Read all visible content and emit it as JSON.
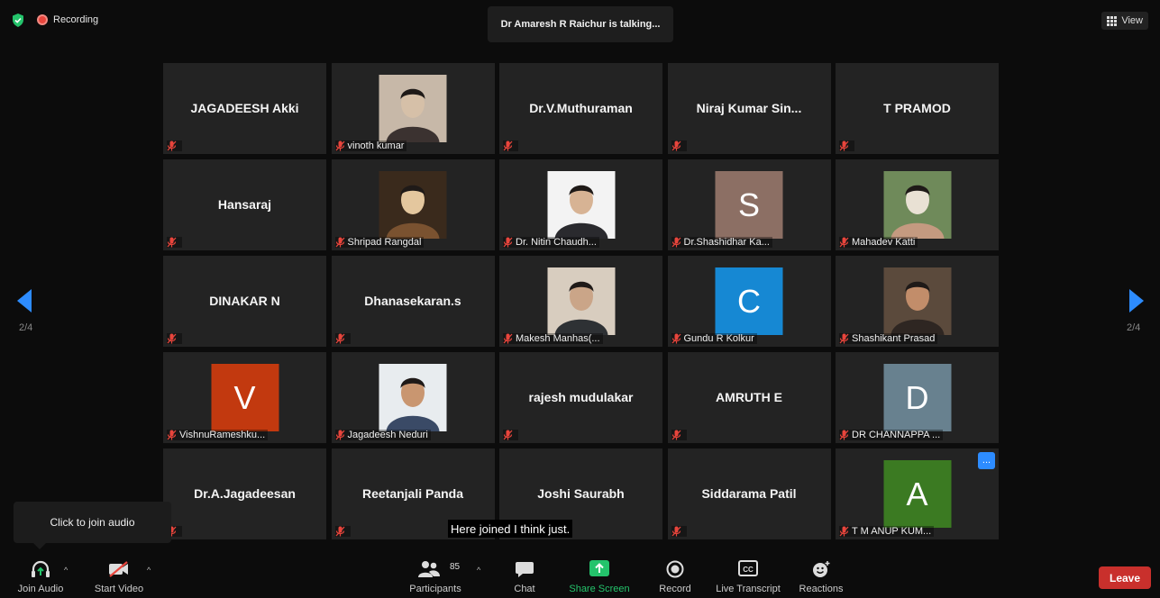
{
  "top": {
    "recording_label": "Recording",
    "talking_text": "Dr Amaresh R Raichur is talking...",
    "view_label": "View"
  },
  "page_indicator_left": "2/4",
  "page_indicator_right": "2/4",
  "tiles": [
    {
      "kind": "name",
      "name": "JAGADEESH Akki",
      "label": ""
    },
    {
      "kind": "photo",
      "name": "",
      "label": "vinoth kumar"
    },
    {
      "kind": "name",
      "name": "Dr.V.Muthuraman",
      "label": ""
    },
    {
      "kind": "name",
      "name": "Niraj  Kumar  Sin...",
      "label": ""
    },
    {
      "kind": "name",
      "name": "T PRAMOD",
      "label": ""
    },
    {
      "kind": "name",
      "name": "Hansaraj",
      "label": ""
    },
    {
      "kind": "photo",
      "name": "",
      "label": "Shripad Rangdal"
    },
    {
      "kind": "photo",
      "name": "",
      "label": "Dr. Nitin Chaudh..."
    },
    {
      "kind": "avatar",
      "letter": "S",
      "color": "#8c6f64",
      "label": "Dr.Shashidhar Ka..."
    },
    {
      "kind": "photo",
      "name": "",
      "label": "Mahadev Katti"
    },
    {
      "kind": "name",
      "name": "DINAKAR N",
      "label": ""
    },
    {
      "kind": "name",
      "name": "Dhanasekaran.s",
      "label": ""
    },
    {
      "kind": "photo",
      "name": "",
      "label": "Makesh Manhas(..."
    },
    {
      "kind": "avatar",
      "letter": "C",
      "color": "#1688d3",
      "label": "Gundu R Kolkur"
    },
    {
      "kind": "photo",
      "name": "",
      "label": "Shashikant Prasad"
    },
    {
      "kind": "avatar",
      "letter": "V",
      "color": "#c2390f",
      "label": "VishnuRameshku..."
    },
    {
      "kind": "photo",
      "name": "",
      "label": "Jagadeesh Neduri"
    },
    {
      "kind": "name",
      "name": "rajesh mudulakar",
      "label": ""
    },
    {
      "kind": "name",
      "name": "AMRUTH E",
      "label": ""
    },
    {
      "kind": "avatar",
      "letter": "D",
      "color": "#68818f",
      "label": "DR CHANNAPPA ..."
    },
    {
      "kind": "name",
      "name": "Dr.A.Jagadeesan",
      "label": ""
    },
    {
      "kind": "name",
      "name": "Reetanjali Panda",
      "label": ""
    },
    {
      "kind": "name",
      "name": "Joshi Saurabh",
      "label": ""
    },
    {
      "kind": "name",
      "name": "Siddarama Patil",
      "label": ""
    },
    {
      "kind": "avatar",
      "letter": "A",
      "color": "#3b7a22",
      "label": "T M ANUP KUM...",
      "more": "..."
    }
  ],
  "tooltip": "Click to join audio",
  "caption": "Here joined I think just.",
  "toolbar": {
    "join_audio": "Join Audio",
    "start_video": "Start Video",
    "participants": "Participants",
    "participants_count": "85",
    "chat": "Chat",
    "share_screen": "Share Screen",
    "record": "Record",
    "live_transcript": "Live Transcript",
    "reactions": "Reactions",
    "leave": "Leave"
  },
  "colors": {
    "share_green": "#24c36b",
    "leave_red": "#c9302c",
    "more_blue": "#2d8cff",
    "muted_red": "#e8453c"
  }
}
